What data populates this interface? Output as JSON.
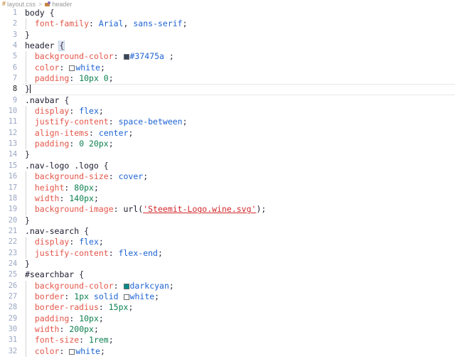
{
  "breadcrumb": {
    "file_icon": "hash-icon",
    "file": "layout.css",
    "separator": ">",
    "symbol_icon": "css-rule-icon",
    "symbol": "header"
  },
  "editor": {
    "language": "css",
    "theme": "light",
    "active_line": 8,
    "first_line": 1,
    "last_line": 32,
    "colors": {
      "background": "#ffffff",
      "line_number": "#9aa7c4",
      "active_line_number": "#1b1b1b",
      "property": "#e45649",
      "keyword_value": "#1c63d4",
      "number_value": "#0d8050",
      "string_value": "#d1282a",
      "selector": "#1a1a2e",
      "punctuation": "#2b2b40",
      "indent_guide": "#d3d3d3",
      "current_line_border": "#e8e8e8",
      "bracket_match_bg": "#dfe6f2"
    },
    "swatch_colors": {
      "header_bg": "#37475a",
      "white": "#ffffff",
      "darkcyan": "#008b8b"
    },
    "lines": [
      {
        "n": "1",
        "indent": false,
        "text": "body {"
      },
      {
        "n": "2",
        "indent": true,
        "text": "  font-family: Arial, sans-serif;"
      },
      {
        "n": "3",
        "indent": false,
        "text": "}"
      },
      {
        "n": "4",
        "indent": false,
        "text": "header {"
      },
      {
        "n": "5",
        "indent": true,
        "text": "  background-color: #37475a ;"
      },
      {
        "n": "6",
        "indent": true,
        "text": "  color: white;"
      },
      {
        "n": "7",
        "indent": true,
        "text": "  padding: 10px 0;"
      },
      {
        "n": "8",
        "indent": false,
        "text": "}"
      },
      {
        "n": "9",
        "indent": false,
        "text": ".navbar {"
      },
      {
        "n": "10",
        "indent": true,
        "text": "  display: flex;"
      },
      {
        "n": "11",
        "indent": true,
        "text": "  justify-content: space-between;"
      },
      {
        "n": "12",
        "indent": true,
        "text": "  align-items: center;"
      },
      {
        "n": "13",
        "indent": true,
        "text": "  padding: 0 20px;"
      },
      {
        "n": "14",
        "indent": false,
        "text": "}"
      },
      {
        "n": "15",
        "indent": false,
        "text": ".nav-logo .logo {"
      },
      {
        "n": "16",
        "indent": true,
        "text": "  background-size: cover;"
      },
      {
        "n": "17",
        "indent": true,
        "text": "  height: 80px;"
      },
      {
        "n": "18",
        "indent": true,
        "text": "  width: 140px;"
      },
      {
        "n": "19",
        "indent": true,
        "text": "  background-image: url('Steemit-Logo.wine.svg');"
      },
      {
        "n": "20",
        "indent": false,
        "text": "}"
      },
      {
        "n": "21",
        "indent": false,
        "text": ".nav-search {"
      },
      {
        "n": "22",
        "indent": true,
        "text": "  display: flex;"
      },
      {
        "n": "23",
        "indent": true,
        "text": "  justify-content: flex-end;"
      },
      {
        "n": "24",
        "indent": false,
        "text": "}"
      },
      {
        "n": "25",
        "indent": false,
        "text": "#searchbar {"
      },
      {
        "n": "26",
        "indent": true,
        "text": "  background-color: darkcyan;"
      },
      {
        "n": "27",
        "indent": true,
        "text": "  border: 1px solid white;"
      },
      {
        "n": "28",
        "indent": true,
        "text": "  border-radius: 15px;"
      },
      {
        "n": "29",
        "indent": true,
        "text": "  padding: 10px;"
      },
      {
        "n": "30",
        "indent": true,
        "text": "  width: 200px;"
      },
      {
        "n": "31",
        "indent": true,
        "text": "  font-size: 1rem;"
      },
      {
        "n": "32",
        "indent": true,
        "text": "  color: white;"
      }
    ],
    "tokens": {
      "l1": [
        {
          "c": "t-sel",
          "v": "body"
        },
        {
          "c": "t-punc",
          "v": " {"
        }
      ],
      "l2": [
        {
          "c": "t-prop",
          "v": "font-family"
        },
        {
          "c": "t-punc",
          "v": ": "
        },
        {
          "c": "t-kw",
          "v": "Arial"
        },
        {
          "c": "t-punc",
          "v": ", "
        },
        {
          "c": "t-kw",
          "v": "sans-serif"
        },
        {
          "c": "t-punc",
          "v": ";"
        }
      ],
      "l3": [
        {
          "c": "t-punc",
          "v": "}"
        }
      ],
      "l4": [
        {
          "c": "t-sel",
          "v": "header"
        },
        {
          "c": "t-punc",
          "v": " "
        },
        {
          "c": "brace-match t-punc",
          "v": "{"
        }
      ],
      "l5": [
        {
          "c": "t-prop",
          "v": "background-color"
        },
        {
          "c": "t-punc",
          "v": ": "
        },
        {
          "c": "swatch",
          "v": "",
          "sw": "#37475a"
        },
        {
          "c": "t-kw",
          "v": "#37475a"
        },
        {
          "c": "t-punc",
          "v": " ;"
        }
      ],
      "l6": [
        {
          "c": "t-prop",
          "v": "color"
        },
        {
          "c": "t-punc",
          "v": ": "
        },
        {
          "c": "swatch",
          "v": "",
          "sw": "#ffffff"
        },
        {
          "c": "t-kw",
          "v": "white"
        },
        {
          "c": "t-punc",
          "v": ";"
        }
      ],
      "l7": [
        {
          "c": "t-prop",
          "v": "padding"
        },
        {
          "c": "t-punc",
          "v": ": "
        },
        {
          "c": "t-num",
          "v": "10px 0"
        },
        {
          "c": "t-punc",
          "v": ";"
        }
      ],
      "l8": [
        {
          "c": "t-punc",
          "v": "}"
        },
        {
          "c": "caret",
          "v": ""
        }
      ],
      "l9": [
        {
          "c": "t-sel",
          "v": ".navbar"
        },
        {
          "c": "t-punc",
          "v": " {"
        }
      ],
      "l10": [
        {
          "c": "t-prop",
          "v": "display"
        },
        {
          "c": "t-punc",
          "v": ": "
        },
        {
          "c": "t-kw",
          "v": "flex"
        },
        {
          "c": "t-punc",
          "v": ";"
        }
      ],
      "l11": [
        {
          "c": "t-prop",
          "v": "justify-content"
        },
        {
          "c": "t-punc",
          "v": ": "
        },
        {
          "c": "t-kw",
          "v": "space-between"
        },
        {
          "c": "t-punc",
          "v": ";"
        }
      ],
      "l12": [
        {
          "c": "t-prop",
          "v": "align-items"
        },
        {
          "c": "t-punc",
          "v": ": "
        },
        {
          "c": "t-kw",
          "v": "center"
        },
        {
          "c": "t-punc",
          "v": ";"
        }
      ],
      "l13": [
        {
          "c": "t-prop",
          "v": "padding"
        },
        {
          "c": "t-punc",
          "v": ": "
        },
        {
          "c": "t-num",
          "v": "0 20px"
        },
        {
          "c": "t-punc",
          "v": ";"
        }
      ],
      "l14": [
        {
          "c": "t-punc",
          "v": "}"
        }
      ],
      "l15": [
        {
          "c": "t-sel",
          "v": ".nav-logo .logo"
        },
        {
          "c": "t-punc",
          "v": " {"
        }
      ],
      "l16": [
        {
          "c": "t-prop",
          "v": "background-size"
        },
        {
          "c": "t-punc",
          "v": ": "
        },
        {
          "c": "t-kw",
          "v": "cover"
        },
        {
          "c": "t-punc",
          "v": ";"
        }
      ],
      "l17": [
        {
          "c": "t-prop",
          "v": "height"
        },
        {
          "c": "t-punc",
          "v": ": "
        },
        {
          "c": "t-num",
          "v": "80px"
        },
        {
          "c": "t-punc",
          "v": ";"
        }
      ],
      "l18": [
        {
          "c": "t-prop",
          "v": "width"
        },
        {
          "c": "t-punc",
          "v": ": "
        },
        {
          "c": "t-num",
          "v": "140px"
        },
        {
          "c": "t-punc",
          "v": ";"
        }
      ],
      "l19": [
        {
          "c": "t-prop",
          "v": "background-image"
        },
        {
          "c": "t-punc",
          "v": ": "
        },
        {
          "c": "t-fn",
          "v": "url("
        },
        {
          "c": "t-link",
          "v": "'Steemit-Logo.wine.svg'"
        },
        {
          "c": "t-fn",
          "v": ")"
        },
        {
          "c": "t-punc",
          "v": ";"
        }
      ],
      "l20": [
        {
          "c": "t-punc",
          "v": "}"
        }
      ],
      "l21": [
        {
          "c": "t-sel",
          "v": ".nav-search"
        },
        {
          "c": "t-punc",
          "v": " {"
        }
      ],
      "l22": [
        {
          "c": "t-prop",
          "v": "display"
        },
        {
          "c": "t-punc",
          "v": ": "
        },
        {
          "c": "t-kw",
          "v": "flex"
        },
        {
          "c": "t-punc",
          "v": ";"
        }
      ],
      "l23": [
        {
          "c": "t-prop",
          "v": "justify-content"
        },
        {
          "c": "t-punc",
          "v": ": "
        },
        {
          "c": "t-kw",
          "v": "flex-end"
        },
        {
          "c": "t-punc",
          "v": ";"
        }
      ],
      "l24": [
        {
          "c": "t-punc",
          "v": "}"
        }
      ],
      "l25": [
        {
          "c": "t-sel",
          "v": "#searchbar"
        },
        {
          "c": "t-punc",
          "v": " {"
        }
      ],
      "l26": [
        {
          "c": "t-prop",
          "v": "background-color"
        },
        {
          "c": "t-punc",
          "v": ": "
        },
        {
          "c": "swatch",
          "v": "",
          "sw": "#008b8b"
        },
        {
          "c": "t-kw",
          "v": "darkcyan"
        },
        {
          "c": "t-punc",
          "v": ";"
        }
      ],
      "l27": [
        {
          "c": "t-prop",
          "v": "border"
        },
        {
          "c": "t-punc",
          "v": ": "
        },
        {
          "c": "t-num",
          "v": "1px"
        },
        {
          "c": "t-punc",
          "v": " "
        },
        {
          "c": "t-kw",
          "v": "solid"
        },
        {
          "c": "t-punc",
          "v": " "
        },
        {
          "c": "swatch",
          "v": "",
          "sw": "#ffffff"
        },
        {
          "c": "t-kw",
          "v": "white"
        },
        {
          "c": "t-punc",
          "v": ";"
        }
      ],
      "l28": [
        {
          "c": "t-prop",
          "v": "border-radius"
        },
        {
          "c": "t-punc",
          "v": ": "
        },
        {
          "c": "t-num",
          "v": "15px"
        },
        {
          "c": "t-punc",
          "v": ";"
        }
      ],
      "l29": [
        {
          "c": "t-prop",
          "v": "padding"
        },
        {
          "c": "t-punc",
          "v": ": "
        },
        {
          "c": "t-num",
          "v": "10px"
        },
        {
          "c": "t-punc",
          "v": ";"
        }
      ],
      "l30": [
        {
          "c": "t-prop",
          "v": "width"
        },
        {
          "c": "t-punc",
          "v": ": "
        },
        {
          "c": "t-num",
          "v": "200px"
        },
        {
          "c": "t-punc",
          "v": ";"
        }
      ],
      "l31": [
        {
          "c": "t-prop",
          "v": "font-size"
        },
        {
          "c": "t-punc",
          "v": ": "
        },
        {
          "c": "t-num",
          "v": "1rem"
        },
        {
          "c": "t-punc",
          "v": ";"
        }
      ],
      "l32": [
        {
          "c": "t-prop",
          "v": "color"
        },
        {
          "c": "t-punc",
          "v": ": "
        },
        {
          "c": "swatch",
          "v": "",
          "sw": "#ffffff"
        },
        {
          "c": "t-kw",
          "v": "white"
        },
        {
          "c": "t-punc",
          "v": ";"
        }
      ]
    }
  }
}
